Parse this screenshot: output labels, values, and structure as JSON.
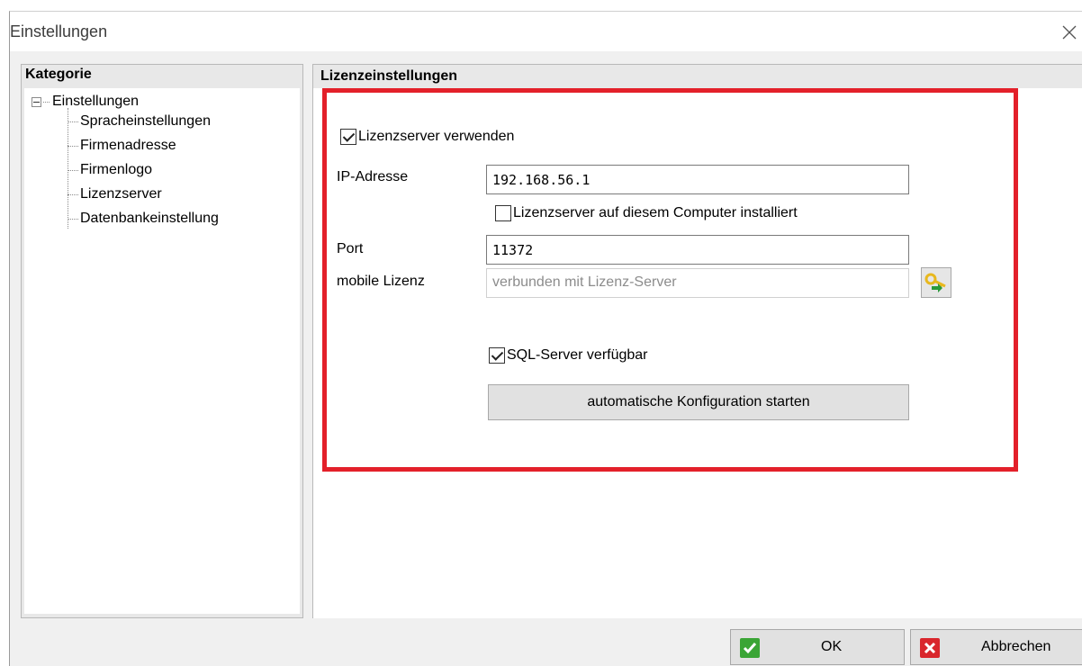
{
  "window": {
    "title": "Einstellungen"
  },
  "category": {
    "header": "Kategorie",
    "root": "Einstellungen",
    "items": [
      {
        "label": "Spracheinstellungen"
      },
      {
        "label": "Firmenadresse"
      },
      {
        "label": "Firmenlogo"
      },
      {
        "label": "Lizenzserver"
      },
      {
        "label": "Datenbankeinstellung"
      }
    ]
  },
  "settings": {
    "header": "Lizenzeinstellungen",
    "use_license_server": {
      "label": "Lizenzserver verwenden",
      "checked": true
    },
    "ip": {
      "label": "IP-Adresse",
      "value": "192.168.56.1"
    },
    "installed_here": {
      "label": "Lizenzserver auf diesem Computer installiert",
      "checked": false
    },
    "port": {
      "label": "Port",
      "value": "11372"
    },
    "mobile": {
      "label": "mobile Lizenz",
      "placeholder": "verbunden mit Lizenz-Server"
    },
    "sql": {
      "label": "SQL-Server verfügbar",
      "checked": true
    },
    "auto_config_label": "automatische Konfiguration starten"
  },
  "footer": {
    "ok_label": "OK",
    "cancel_label": "Abbrechen"
  },
  "colors": {
    "highlight": "#e3202a",
    "ok_icon": "#3aa535",
    "cancel_icon": "#d9262c",
    "key_icon": "#e8b81e"
  }
}
